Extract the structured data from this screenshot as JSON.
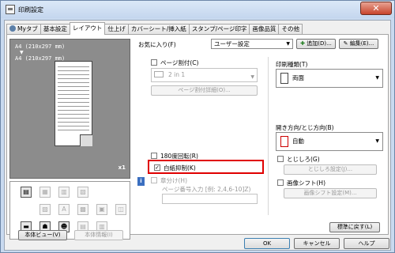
{
  "window": {
    "title": "印刷設定",
    "close_label": "✕"
  },
  "tabs": [
    "Myタブ",
    "基本設定",
    "レイアウト",
    "仕上げ",
    "カバーシート/挿入紙",
    "スタンプ/ページ印字",
    "画像品質",
    "その他"
  ],
  "preview": {
    "paper_top": "A4 (210x297 mm)",
    "arrow": "▼",
    "paper_bottom": "A4 (210x297 mm)",
    "copies": "x1",
    "view_button": "本体ビュー(V)",
    "info_button": "本体情報(I)"
  },
  "favorites": {
    "label": "お気に入り(F)",
    "value": "ユーザー設定",
    "add_button": "追加(D)...",
    "edit_button": "編集(E)..."
  },
  "combine": {
    "label": "ページ割付(C)",
    "value": "2 in 1",
    "detail_button": "ページ割付詳細(O)..."
  },
  "rotate180": {
    "label": "180度回転(R)"
  },
  "skip_blank": {
    "label": "白紙抑制(K)",
    "checked": true
  },
  "chapters": {
    "label": "章分け(H)",
    "input_label": "ページ番号入力 [例: 2,4,6-10]Z)"
  },
  "print_type": {
    "label": "印刷種類(T)",
    "value": "両面"
  },
  "binding": {
    "label": "開き方向/とじ方向(B)",
    "value": "自動"
  },
  "margin": {
    "label": "とじしろ(G)",
    "button": "とじしろ設定(J)..."
  },
  "image_shift": {
    "label": "画像シフト(H)",
    "button": "画像シフト設定(M)..."
  },
  "default_button": "標準に戻す(L)",
  "footer": {
    "ok": "OK",
    "cancel": "キャンセル",
    "help": "ヘルプ"
  },
  "check_mark": "✓",
  "arrow_down": "▼"
}
